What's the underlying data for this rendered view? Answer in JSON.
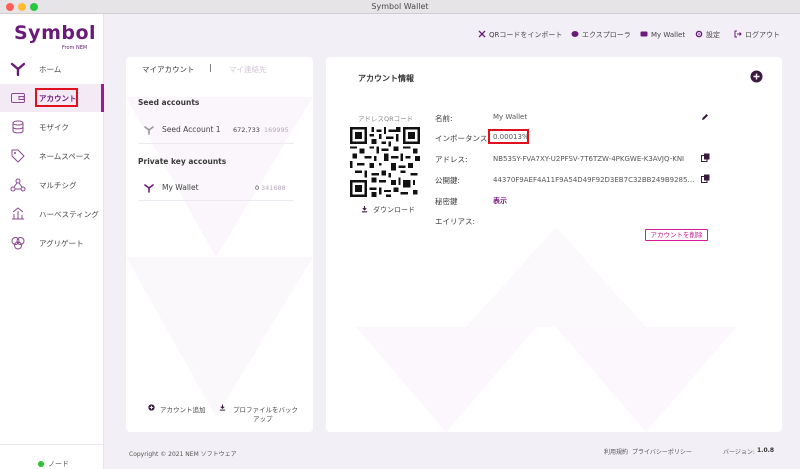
{
  "window": {
    "title": "Symbol Wallet"
  },
  "brand": {
    "logo_text": "Symbol",
    "logo_sub": "From NEM",
    "accent": "#6a1b7a",
    "highlight": "#e0101e",
    "pink": "#d61a9a"
  },
  "sidebar": {
    "items": [
      {
        "label": "ホーム",
        "icon": "symbol-home-icon"
      },
      {
        "label": "アカウント",
        "icon": "wallet-icon",
        "active": true
      },
      {
        "label": "モザイク",
        "icon": "coins-icon"
      },
      {
        "label": "ネームスペース",
        "icon": "tag-icon"
      },
      {
        "label": "マルチシグ",
        "icon": "multisig-icon"
      },
      {
        "label": "ハーベスティング",
        "icon": "harvest-icon"
      },
      {
        "label": "アグリゲート",
        "icon": "aggregate-icon"
      }
    ],
    "node_label": "ノード"
  },
  "topbar": {
    "qr_import": "QRコードをインポート",
    "explorer": "エクスプローラ",
    "wallet": "My Wallet",
    "settings": "設定",
    "logout": "ログアウト"
  },
  "accounts_panel": {
    "tabs": [
      {
        "label": "マイアカウント"
      },
      {
        "label": "マイ連絡先"
      }
    ],
    "seed_heading": "Seed accounts",
    "seed_accounts": [
      {
        "name": "Seed Account 1",
        "balance_int": "672,733",
        "balance_frac": "169995"
      }
    ],
    "private_heading": "Private key accounts",
    "private_accounts": [
      {
        "name": "My Wallet",
        "balance_int": "0",
        "balance_frac": "341688"
      }
    ],
    "add_account": "アカウント追加",
    "backup_profile_line1": "プロファイルをバック",
    "backup_profile_line2": "アップ"
  },
  "info_panel": {
    "title": "アカウント情報",
    "qr_label": "アドレスQRコード",
    "download": "ダウンロード",
    "fields": {
      "name_label": "名前:",
      "name_value": "My Wallet",
      "importance_label": "インポータンス:",
      "importance_value": "0.00013%",
      "address_label": "アドレス:",
      "address_value": "NB53SY-FVA7XY-U2PFSV-7T6TZW-4PKGWE-K3AVJQ-KNI",
      "pubkey_label": "公開鍵:",
      "pubkey_value": "44370F9AEF4A11F9A54D49F92D3EB7C32BB249B9285E6D...",
      "privkey_label": "秘密鍵",
      "privkey_value": "表示",
      "alias_label": "エイリアス:"
    },
    "delete_button": "アカウントを削除"
  },
  "footer": {
    "copyright": "Copyright © 2021 NEM ソフトウェア",
    "terms": "利用規約",
    "privacy": "プライバシーポリシー",
    "version_label": "バージョン:",
    "version": "1.0.8"
  }
}
